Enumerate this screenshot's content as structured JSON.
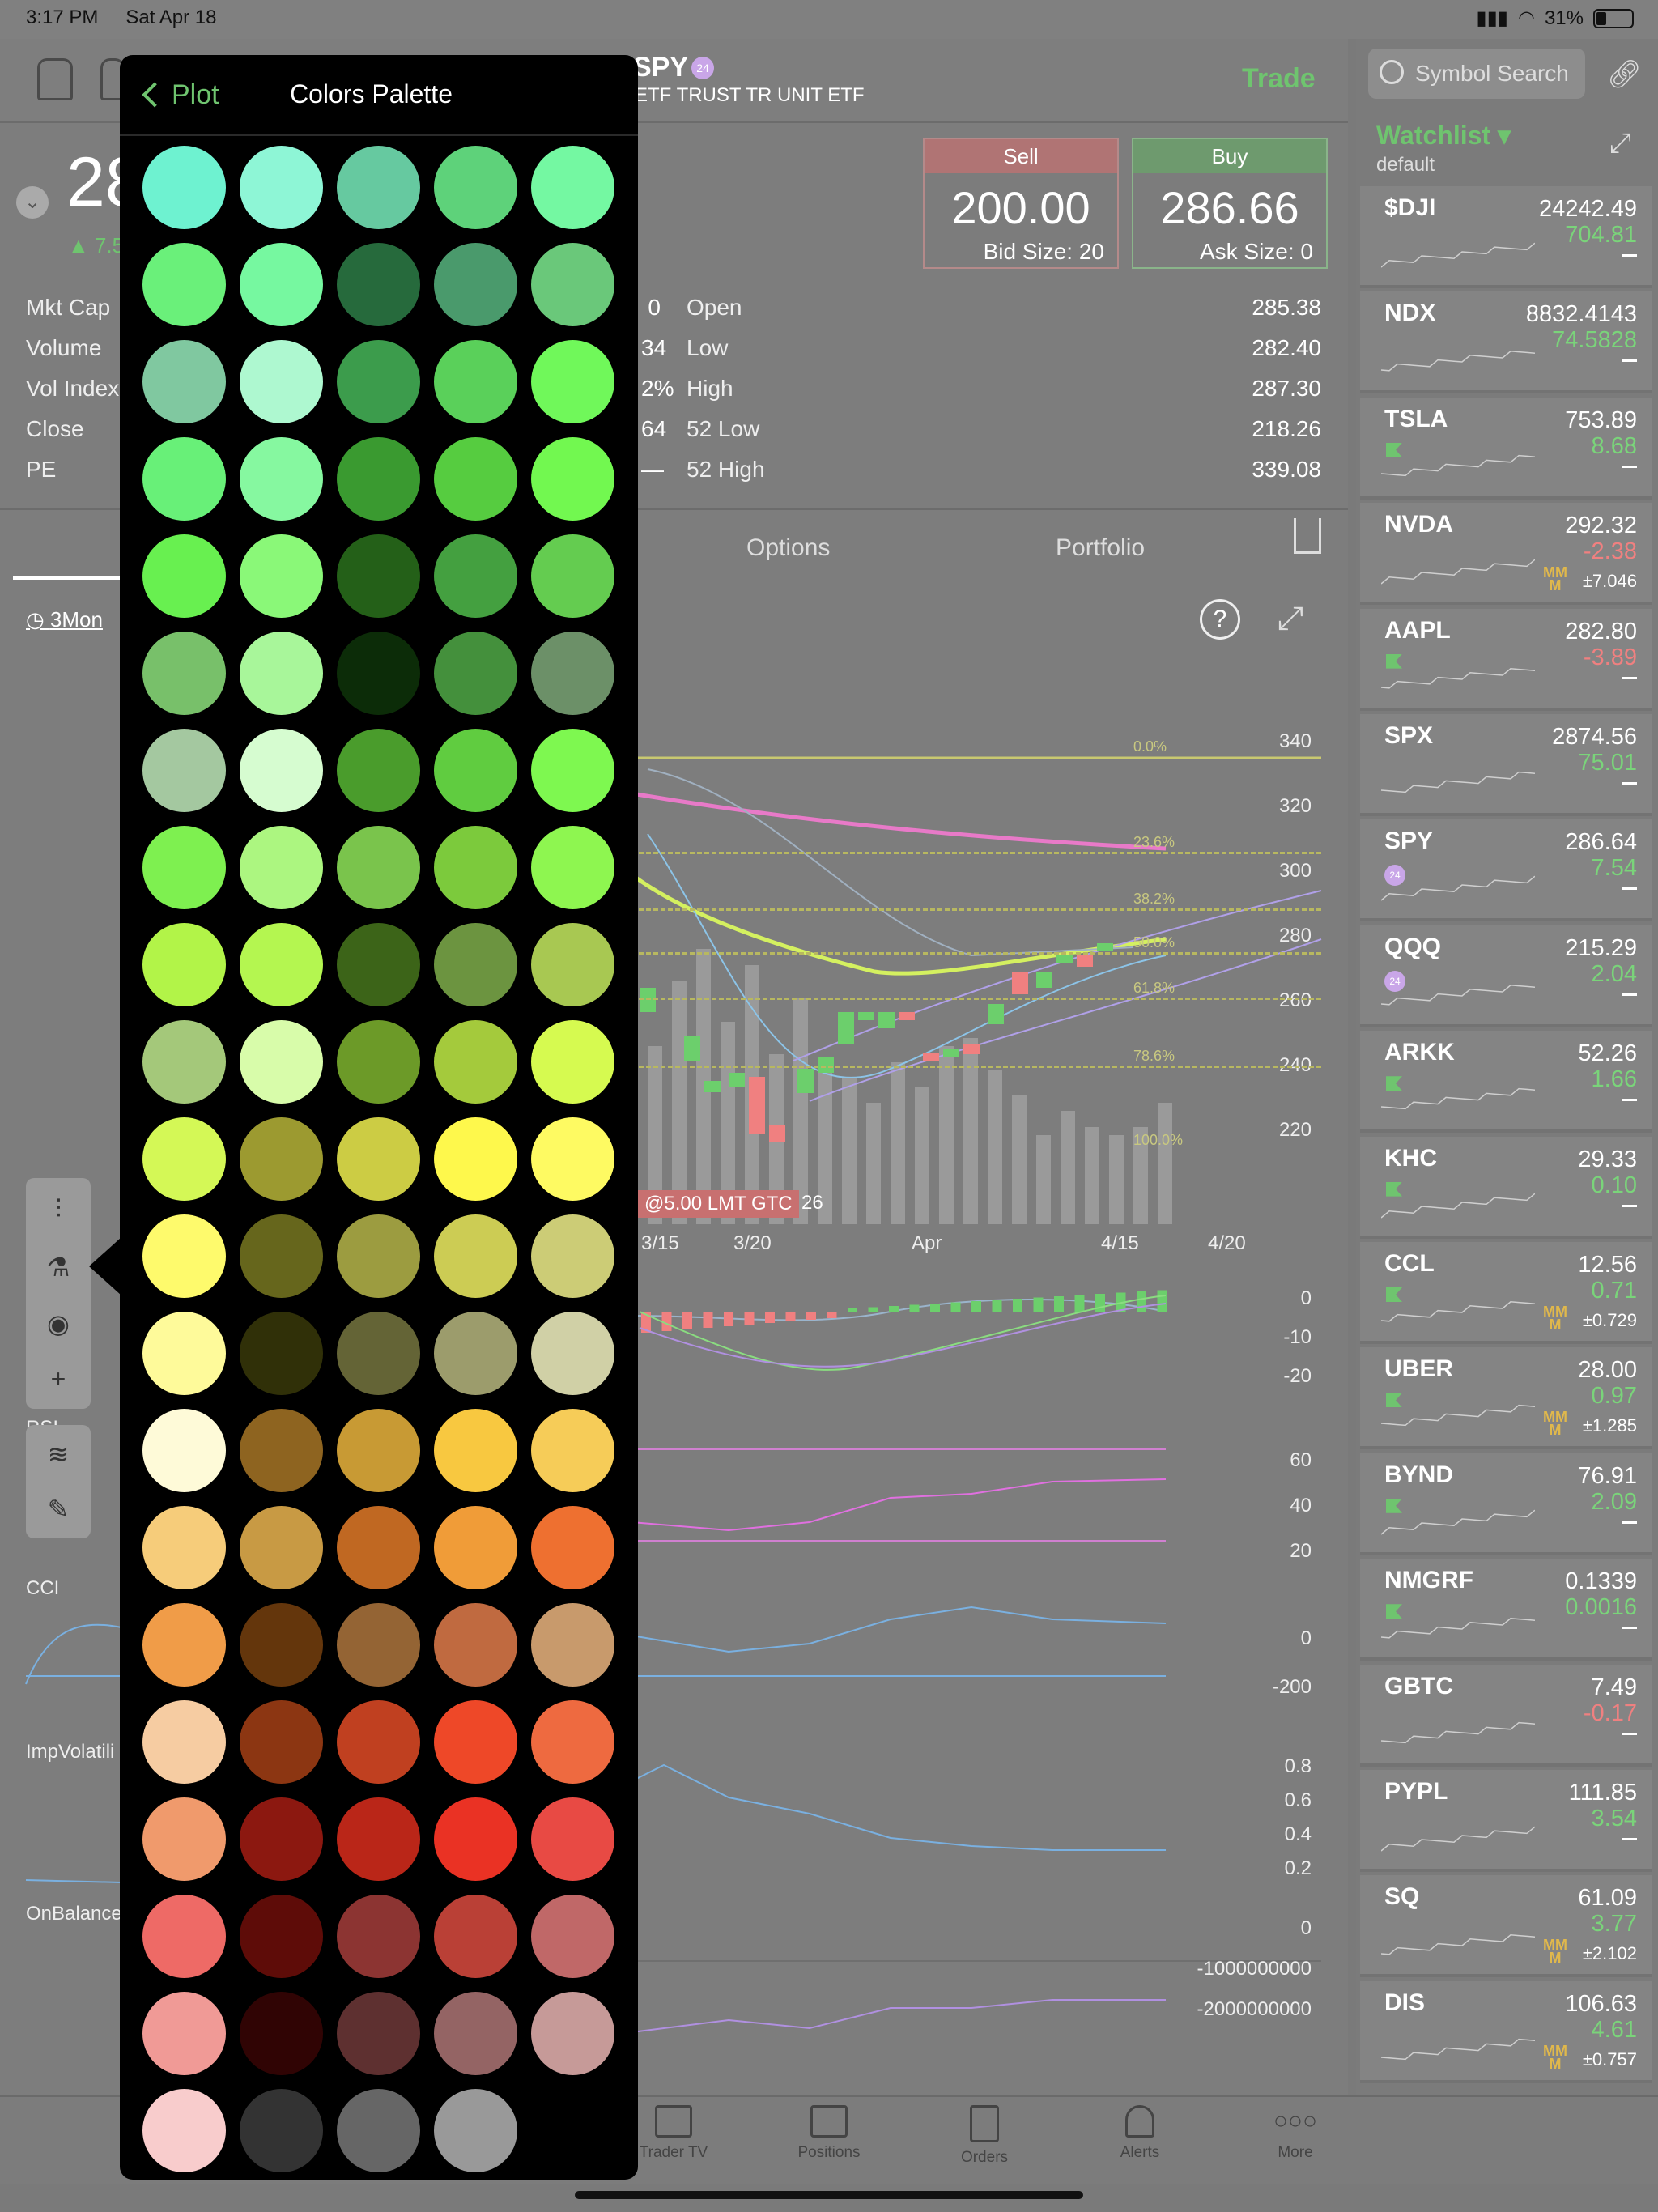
{
  "status": {
    "time": "3:17 PM",
    "date": "Sat Apr 18",
    "battery": "31%"
  },
  "header": {
    "symbol": "SPY",
    "badge": "24",
    "subtitle": "ETF TRUST TR UNIT ETF",
    "trade_label": "Trade",
    "price_prefix": "28",
    "change_prefix": "▲ 7.5"
  },
  "quote": {
    "sell_label": "Sell",
    "sell_price": "200.00",
    "bid_size": "Bid Size: 20",
    "buy_label": "Buy",
    "buy_price": "286.66",
    "ask_size": "Ask Size: 0"
  },
  "stats": {
    "left_labels": [
      "Mkt Cap",
      "Volume",
      "Vol Index",
      "Close",
      "PE"
    ],
    "left_partial_values": [
      "0",
      "34",
      "2%",
      "64",
      "—"
    ],
    "right_labels": [
      "Open",
      "Low",
      "High",
      "52 Low",
      "52 High"
    ],
    "right_values": [
      "285.38",
      "282.40",
      "287.30",
      "218.26",
      "339.08"
    ]
  },
  "tabs": {
    "options": "Options",
    "portfolio": "Portfolio"
  },
  "chart": {
    "range_label": "3Mon",
    "price_axis": [
      "340",
      "320",
      "300",
      "280",
      "260",
      "240",
      "220"
    ],
    "fib_levels": [
      "0.0%",
      "23.6%",
      "38.2%",
      "50.0%",
      "61.8%",
      "78.6%",
      "100.0%"
    ],
    "x_labels": [
      "3/15",
      "3/20",
      "Apr",
      "4/15",
      "4/20"
    ],
    "order_tag": "@5.00 LMT GTC",
    "order_tag_suffix": "26",
    "macd_axis": [
      "0",
      "-10",
      "-20"
    ],
    "rsi_label": "RSI",
    "rsi_axis": [
      "60",
      "40",
      "20"
    ],
    "cci_label": "CCI",
    "cci_axis": [
      "0",
      "-200"
    ],
    "iv_label": "ImpVolatili",
    "iv_axis": [
      "0.8",
      "0.6",
      "0.4",
      "0.2"
    ],
    "obv_label": "OnBalance",
    "obv_axis": [
      "0",
      "-1000000000",
      "-2000000000"
    ]
  },
  "palette": {
    "back_label": "Plot",
    "title": "Colors Palette",
    "colors": [
      [
        "#6ef2d0",
        "#8ef6d6",
        "#66c9a0",
        "#5ed27a",
        "#74f8a2"
      ],
      [
        "#6af07a",
        "#76f8a0",
        "#266a3c",
        "#4a9a6c",
        "#6ac87a"
      ],
      [
        "#80c8a0",
        "#aef8d0",
        "#3c9c4c",
        "#5ad05a",
        "#70f85a"
      ],
      [
        "#68f078",
        "#86f8a0",
        "#3a9a30",
        "#56cc40",
        "#72f850"
      ],
      [
        "#68f050",
        "#8af878",
        "#246018",
        "#44a040",
        "#64cc50"
      ],
      [
        "#78c06a",
        "#a8f69a",
        "#0c2c08",
        "#44903c",
        "#6c9068"
      ],
      [
        "#a4c8a0",
        "#d6fcd0",
        "#4a9c2c",
        "#60cc40",
        "#7ef850"
      ],
      [
        "#7ef050",
        "#acf680",
        "#7ac44c",
        "#7cca3c",
        "#8ef650"
      ],
      [
        "#b2f448",
        "#b4f650",
        "#3c6418",
        "#6c9440",
        "#a8c852"
      ],
      [
        "#a4c87a",
        "#d8fcaa",
        "#6c9a28",
        "#a4ca3c",
        "#d6fa50"
      ],
      [
        "#d4f856",
        "#9c9a30",
        "#cccc44",
        "#fef84c",
        "#fefa62"
      ],
      [
        "#fefa6c",
        "#66661c",
        "#9c9c40",
        "#cccc54",
        "#cccc76"
      ],
      [
        "#fefa9a",
        "#303008",
        "#646436",
        "#9c9c6c",
        "#d0d0a6"
      ],
      [
        "#fefad8",
        "#8e6420",
        "#c89a34",
        "#f8c840",
        "#f6cc58"
      ],
      [
        "#f6cc7a",
        "#c89a44",
        "#c06822",
        "#f09c38",
        "#ee7030"
      ],
      [
        "#f09c48",
        "#64360c",
        "#946434",
        "#c06a40",
        "#c89a6c"
      ],
      [
        "#f6cca2",
        "#8c3612",
        "#c04020",
        "#ee4828",
        "#ee6a40"
      ],
      [
        "#f09a6c",
        "#8c1810",
        "#ba2618",
        "#ea3224",
        "#e84a44"
      ],
      [
        "#ee6a66",
        "#5e0c08",
        "#8c3432",
        "#ba4036",
        "#c06868"
      ],
      [
        "#f09a96",
        "#300404",
        "#5e3030",
        "#946464",
        "#c69a98"
      ],
      [
        "#f8cccc",
        "#333333",
        "#666666",
        "#999999"
      ]
    ]
  },
  "watchlist": {
    "search_placeholder": "Symbol Search",
    "title": "Watchlist",
    "subtitle": "default",
    "items": [
      {
        "sym": "$DJI",
        "price": "24242.49",
        "chg": "704.81",
        "dir": "up"
      },
      {
        "sym": "NDX",
        "price": "8832.4143",
        "chg": "74.5828",
        "dir": "up"
      },
      {
        "sym": "TSLA",
        "price": "753.89",
        "chg": "8.68",
        "dir": "up",
        "flag": true
      },
      {
        "sym": "NVDA",
        "price": "292.32",
        "chg": "-2.38",
        "dir": "down",
        "mm": "±7.046"
      },
      {
        "sym": "AAPL",
        "price": "282.80",
        "chg": "-3.89",
        "dir": "down",
        "flag": true
      },
      {
        "sym": "SPX",
        "price": "2874.56",
        "chg": "75.01",
        "dir": "up"
      },
      {
        "sym": "SPY",
        "price": "286.64",
        "chg": "7.54",
        "dir": "up",
        "badge": "24"
      },
      {
        "sym": "QQQ",
        "price": "215.29",
        "chg": "2.04",
        "dir": "up",
        "badge": "24"
      },
      {
        "sym": "ARKK",
        "price": "52.26",
        "chg": "1.66",
        "dir": "up",
        "flag": true
      },
      {
        "sym": "KHC",
        "price": "29.33",
        "chg": "0.10",
        "dir": "up",
        "flag": true
      },
      {
        "sym": "CCL",
        "price": "12.56",
        "chg": "0.71",
        "dir": "up",
        "flag": true,
        "mm": "±0.729"
      },
      {
        "sym": "UBER",
        "price": "28.00",
        "chg": "0.97",
        "dir": "up",
        "flag": true,
        "mm": "±1.285"
      },
      {
        "sym": "BYND",
        "price": "76.91",
        "chg": "2.09",
        "dir": "up",
        "flag": true
      },
      {
        "sym": "NMGRF",
        "price": "0.1339",
        "chg": "0.0016",
        "dir": "up",
        "flag": true
      },
      {
        "sym": "GBTC",
        "price": "7.49",
        "chg": "-0.17",
        "dir": "down"
      },
      {
        "sym": "PYPL",
        "price": "111.85",
        "chg": "3.54",
        "dir": "up"
      },
      {
        "sym": "SQ",
        "price": "61.09",
        "chg": "3.77",
        "dir": "up",
        "mm": "±2.102"
      },
      {
        "sym": "DIS",
        "price": "106.63",
        "chg": "4.61",
        "dir": "up",
        "mm": "±0.757"
      }
    ]
  },
  "tabbar": [
    "Trader TV",
    "Positions",
    "Orders",
    "Alerts",
    "More"
  ],
  "colors": {
    "accent_green": "#6fc46f",
    "down_red": "#f08080",
    "sell_red": "#b07474",
    "buy_green": "#6e9a6e"
  }
}
